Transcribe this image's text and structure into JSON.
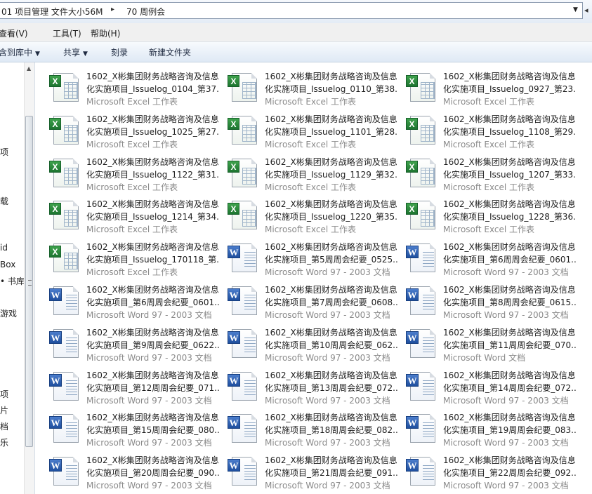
{
  "address": {
    "crumbs": [
      "01 项目管理 文件大小56M",
      "70 周例会"
    ],
    "separator": "▸",
    "dropdown_glyph": "▼",
    "tail_glyph": "◂"
  },
  "menu": [
    "查看(V)",
    "工具(T)",
    "帮助(H)"
  ],
  "commands": {
    "include_library": "含到库中",
    "share": "共享",
    "burn": "刻录",
    "new_folder": "新建文件夹",
    "dropdown_glyph": "▼"
  },
  "nav": [
    "项",
    "载",
    "id",
    "Box",
    "• 书库",
    "游戏",
    "项",
    "片",
    "档",
    "乐"
  ],
  "file_type_colors": {
    "excel": "#1d7430",
    "word": "#1f4f9e"
  },
  "files": [
    {
      "kind": "excel",
      "name1": "1602_X彬集团财务战略咨询及信息",
      "name2": "化实施项目_Issuelog_0104_第37...",
      "type": "Microsoft Excel 工作表"
    },
    {
      "kind": "excel",
      "name1": "1602_X彬集团财务战略咨询及信息",
      "name2": "化实施项目_Issuelog_0110_第38...",
      "type": "Microsoft Excel 工作表"
    },
    {
      "kind": "excel",
      "name1": "1602_X彬集团财务战略咨询及信息",
      "name2": "化实施项目_Issuelog_0927_第23...",
      "type": "Microsoft Excel 工作表"
    },
    {
      "kind": "excel",
      "name1": "1602_X彬集团财务战略咨询及信息",
      "name2": "化实施项目_Issuelog_1025_第27...",
      "type": "Microsoft Excel 工作表"
    },
    {
      "kind": "excel",
      "name1": "1602_X彬集团财务战略咨询及信息",
      "name2": "化实施项目_Issuelog_1101_第28...",
      "type": "Microsoft Excel 工作表"
    },
    {
      "kind": "excel",
      "name1": "1602_X彬集团财务战略咨询及信息",
      "name2": "化实施项目_Issuelog_1108_第29...",
      "type": "Microsoft Excel 工作表"
    },
    {
      "kind": "excel",
      "name1": "1602_X彬集团财务战略咨询及信息",
      "name2": "化实施项目_Issuelog_1122_第31...",
      "type": "Microsoft Excel 工作表"
    },
    {
      "kind": "excel",
      "name1": "1602_X彬集团财务战略咨询及信息",
      "name2": "化实施项目_Issuelog_1129_第32...",
      "type": "Microsoft Excel 工作表"
    },
    {
      "kind": "excel",
      "name1": "1602_X彬集团财务战略咨询及信息",
      "name2": "化实施项目_Issuelog_1207_第33...",
      "type": "Microsoft Excel 工作表"
    },
    {
      "kind": "excel",
      "name1": "1602_X彬集团财务战略咨询及信息",
      "name2": "化实施项目_Issuelog_1214_第34...",
      "type": "Microsoft Excel 工作表"
    },
    {
      "kind": "excel",
      "name1": "1602_X彬集团财务战略咨询及信息",
      "name2": "化实施项目_Issuelog_1220_第35...",
      "type": "Microsoft Excel 工作表"
    },
    {
      "kind": "excel",
      "name1": "1602_X彬集团财务战略咨询及信息",
      "name2": "化实施项目_Issuelog_1228_第36...",
      "type": "Microsoft Excel 工作表"
    },
    {
      "kind": "excel",
      "name1": "1602_X彬集团财务战略咨询及信息",
      "name2": "化实施项目_Issuelog_170118_第...",
      "type": "Microsoft Excel 工作表"
    },
    {
      "kind": "word",
      "name1": "1602_X彬集团财务战略咨询及信息",
      "name2": "化实施项目_第5周周会纪要_0525...",
      "type": "Microsoft Word 97 - 2003 文档"
    },
    {
      "kind": "word",
      "name1": "1602_X彬集团财务战略咨询及信息",
      "name2": "化实施项目_第6周周会纪要_0601...",
      "type": "Microsoft Word 97 - 2003 文档"
    },
    {
      "kind": "word",
      "name1": "1602_X彬集团财务战略咨询及信息",
      "name2": "化实施项目_第6周周会纪要_0601...",
      "type": "Microsoft Word 97 - 2003 文档"
    },
    {
      "kind": "word",
      "name1": "1602_X彬集团财务战略咨询及信息",
      "name2": "化实施项目_第7周周会纪要_0608...",
      "type": "Microsoft Word 97 - 2003 文档"
    },
    {
      "kind": "word",
      "name1": "1602_X彬集团财务战略咨询及信息",
      "name2": "化实施项目_第8周周会纪要_0615...",
      "type": "Microsoft Word 97 - 2003 文档"
    },
    {
      "kind": "word",
      "name1": "1602_X彬集团财务战略咨询及信息",
      "name2": "化实施项目_第9周周会纪要_0622...",
      "type": "Microsoft Word 97 - 2003 文档"
    },
    {
      "kind": "word",
      "name1": "1602_X彬集团财务战略咨询及信息",
      "name2": "化实施项目_第10周周会纪要_062...",
      "type": "Microsoft Word 97 - 2003 文档"
    },
    {
      "kind": "word",
      "name1": "1602_X彬集团财务战略咨询及信息",
      "name2": "化实施项目_第11周周会纪要_070...",
      "type": "Microsoft Word 文档"
    },
    {
      "kind": "word",
      "name1": "1602_X彬集团财务战略咨询及信息",
      "name2": "化实施项目_第12周周会纪要_071...",
      "type": "Microsoft Word 97 - 2003 文档"
    },
    {
      "kind": "word",
      "name1": "1602_X彬集团财务战略咨询及信息",
      "name2": "化实施项目_第13周周会纪要_072...",
      "type": "Microsoft Word 97 - 2003 文档"
    },
    {
      "kind": "word",
      "name1": "1602_X彬集团财务战略咨询及信息",
      "name2": "化实施项目_第14周周会纪要_072...",
      "type": "Microsoft Word 97 - 2003 文档"
    },
    {
      "kind": "word",
      "name1": "1602_X彬集团财务战略咨询及信息",
      "name2": "化实施项目_第15周周会纪要_080...",
      "type": "Microsoft Word 97 - 2003 文档"
    },
    {
      "kind": "word",
      "name1": "1602_X彬集团财务战略咨询及信息",
      "name2": "化实施项目_第18周周会纪要_082...",
      "type": "Microsoft Word 97 - 2003 文档"
    },
    {
      "kind": "word",
      "name1": "1602_X彬集团财务战略咨询及信息",
      "name2": "化实施项目_第19周周会纪要_083...",
      "type": "Microsoft Word 97 - 2003 文档"
    },
    {
      "kind": "word",
      "name1": "1602_X彬集团财务战略咨询及信息",
      "name2": "化实施项目_第20周周会纪要_090...",
      "type": "Microsoft Word 97 - 2003 文档"
    },
    {
      "kind": "word",
      "name1": "1602_X彬集团财务战略咨询及信息",
      "name2": "化实施项目_第21周周会纪要_091...",
      "type": "Microsoft Word 97 - 2003 文档"
    },
    {
      "kind": "word",
      "name1": "1602_X彬集团财务战略咨询及信息",
      "name2": "化实施项目_第22周周会纪要_092...",
      "type": "Microsoft Word 97 - 2003 文档"
    }
  ]
}
